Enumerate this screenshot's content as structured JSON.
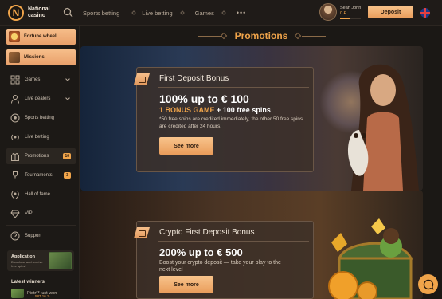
{
  "header": {
    "logo_letter": "N",
    "logo_line1": "National",
    "logo_line2": "casino",
    "nav": [
      "Sports betting",
      "Live betting",
      "Games"
    ],
    "more": "•••",
    "user": {
      "name": "Sean John",
      "balance": "0 ₽",
      "progress": 0.45
    },
    "deposit_label": "Deposit"
  },
  "sidebar": {
    "featured": [
      {
        "label": "Fortune wheel",
        "icon": "fortune-wheel-icon"
      },
      {
        "label": "Missions",
        "icon": "missions-icon"
      }
    ],
    "items": [
      {
        "label": "Games",
        "icon": "games-grid-icon",
        "expandable": true
      },
      {
        "label": "Live dealers",
        "icon": "live-dealer-icon",
        "expandable": true
      },
      {
        "label": "Sports betting",
        "icon": "soccer-ball-icon"
      },
      {
        "label": "Live betting",
        "icon": "live-signal-icon"
      },
      {
        "label": "Promotions",
        "icon": "gift-icon",
        "badge": "16",
        "active": true
      },
      {
        "label": "Tournaments",
        "icon": "trophy-icon",
        "badge": "3"
      },
      {
        "label": "Hall of fame",
        "icon": "laurel-icon"
      },
      {
        "label": "VIP",
        "icon": "diamond-icon"
      },
      {
        "label": "Support",
        "icon": "question-icon"
      }
    ],
    "app": {
      "title": "Application",
      "subtitle": "Download and receive free spins!"
    },
    "winners_title": "Latest winners",
    "winner": {
      "name": "Piotr** just won",
      "amount": "587.16 zł"
    }
  },
  "main": {
    "title": "Promotions",
    "promos": [
      {
        "title": "First Deposit Bonus",
        "headline": "100% up to € 100",
        "highlight": "1 BONUS GAME",
        "extra": "+ 100 free spins",
        "description": "*50 free spins are credited immediately, the other 50 free spins are credited after 24 hours.",
        "button": "See more"
      },
      {
        "title": "Crypto First Deposit Bonus",
        "headline": "200% up to € 500",
        "description": "Boost your crypto deposit — take your play to the next level",
        "button": "See more"
      }
    ]
  },
  "colors": {
    "accent": "#f0a44a",
    "background": "#1a1714",
    "panel": "#3c3028"
  }
}
